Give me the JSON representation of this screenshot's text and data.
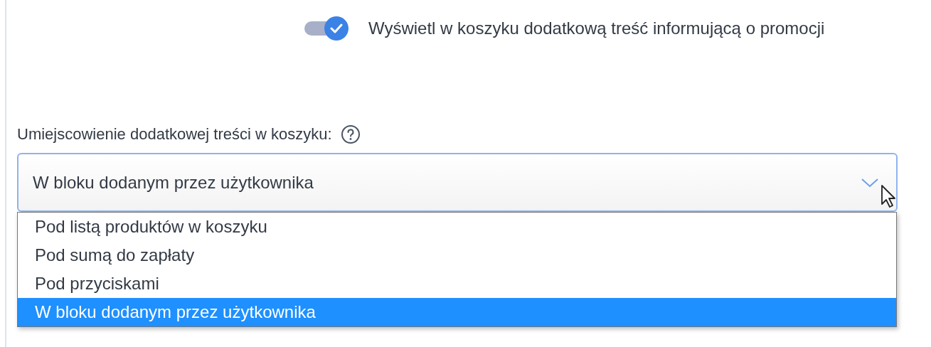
{
  "toggle": {
    "on": true,
    "label": "Wyświetl w koszyku dodatkową treść informującą o promocji"
  },
  "placement": {
    "label": "Umiejscowienie dodatkowej treści w koszyku:",
    "value": "W bloku dodanym przez użytkownika",
    "expanded": true,
    "options": [
      {
        "label": "Pod listą produktów w koszyku",
        "selected": false
      },
      {
        "label": "Pod sumą do zapłaty",
        "selected": false
      },
      {
        "label": "Pod przyciskami",
        "selected": false
      },
      {
        "label": "W bloku dodanym przez użytkownika",
        "selected": true
      }
    ]
  }
}
